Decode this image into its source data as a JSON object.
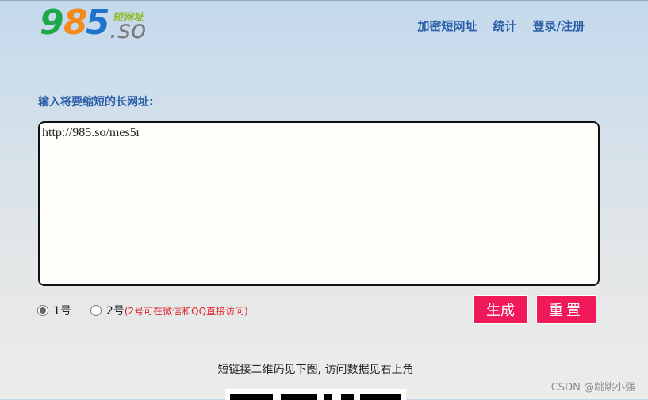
{
  "logo": {
    "digit1": "9",
    "digit2": "8",
    "digit3": "5",
    "suffix": ".so",
    "tagline": "短网址"
  },
  "nav": [
    {
      "label": "加密短网址"
    },
    {
      "label": "统计"
    },
    {
      "label": "登录/注册"
    }
  ],
  "form": {
    "label": "输入将要缩短的长网址:",
    "url_value": "http://985.so/mes5r",
    "options": [
      {
        "label": "1号",
        "selected": true
      },
      {
        "label": "2号",
        "note": "(2号可在微信和QQ直接访问)",
        "selected": false
      }
    ],
    "generate_label": "生成",
    "reset_label": "重置"
  },
  "qr": {
    "caption": "短链接二维码见下图, 访问数据见右上角"
  },
  "watermark": "CSDN @跳跳小强",
  "colors": {
    "nav_text": "#2a5ea8",
    "button_bg": "#f0195a",
    "note_text": "#e0242c"
  }
}
